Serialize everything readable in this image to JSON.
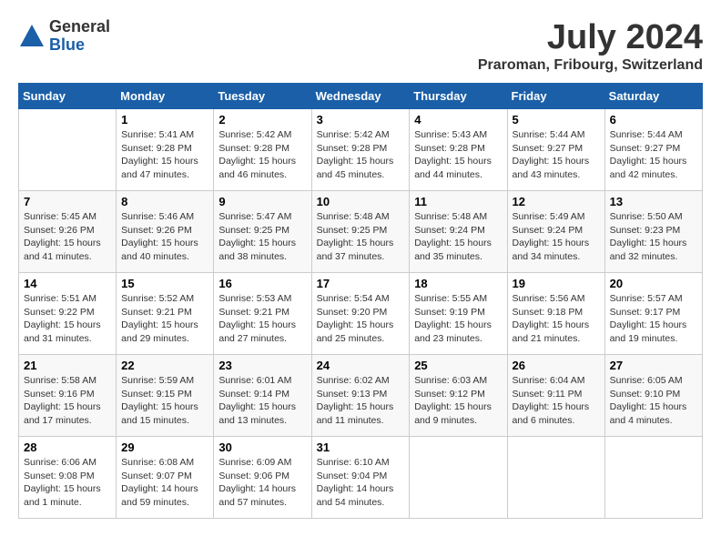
{
  "logo": {
    "general": "General",
    "blue": "Blue"
  },
  "title": "July 2024",
  "location": "Praroman, Fribourg, Switzerland",
  "days_of_week": [
    "Sunday",
    "Monday",
    "Tuesday",
    "Wednesday",
    "Thursday",
    "Friday",
    "Saturday"
  ],
  "weeks": [
    [
      {
        "num": "",
        "info": ""
      },
      {
        "num": "1",
        "info": "Sunrise: 5:41 AM\nSunset: 9:28 PM\nDaylight: 15 hours\nand 47 minutes."
      },
      {
        "num": "2",
        "info": "Sunrise: 5:42 AM\nSunset: 9:28 PM\nDaylight: 15 hours\nand 46 minutes."
      },
      {
        "num": "3",
        "info": "Sunrise: 5:42 AM\nSunset: 9:28 PM\nDaylight: 15 hours\nand 45 minutes."
      },
      {
        "num": "4",
        "info": "Sunrise: 5:43 AM\nSunset: 9:28 PM\nDaylight: 15 hours\nand 44 minutes."
      },
      {
        "num": "5",
        "info": "Sunrise: 5:44 AM\nSunset: 9:27 PM\nDaylight: 15 hours\nand 43 minutes."
      },
      {
        "num": "6",
        "info": "Sunrise: 5:44 AM\nSunset: 9:27 PM\nDaylight: 15 hours\nand 42 minutes."
      }
    ],
    [
      {
        "num": "7",
        "info": "Sunrise: 5:45 AM\nSunset: 9:26 PM\nDaylight: 15 hours\nand 41 minutes."
      },
      {
        "num": "8",
        "info": "Sunrise: 5:46 AM\nSunset: 9:26 PM\nDaylight: 15 hours\nand 40 minutes."
      },
      {
        "num": "9",
        "info": "Sunrise: 5:47 AM\nSunset: 9:25 PM\nDaylight: 15 hours\nand 38 minutes."
      },
      {
        "num": "10",
        "info": "Sunrise: 5:48 AM\nSunset: 9:25 PM\nDaylight: 15 hours\nand 37 minutes."
      },
      {
        "num": "11",
        "info": "Sunrise: 5:48 AM\nSunset: 9:24 PM\nDaylight: 15 hours\nand 35 minutes."
      },
      {
        "num": "12",
        "info": "Sunrise: 5:49 AM\nSunset: 9:24 PM\nDaylight: 15 hours\nand 34 minutes."
      },
      {
        "num": "13",
        "info": "Sunrise: 5:50 AM\nSunset: 9:23 PM\nDaylight: 15 hours\nand 32 minutes."
      }
    ],
    [
      {
        "num": "14",
        "info": "Sunrise: 5:51 AM\nSunset: 9:22 PM\nDaylight: 15 hours\nand 31 minutes."
      },
      {
        "num": "15",
        "info": "Sunrise: 5:52 AM\nSunset: 9:21 PM\nDaylight: 15 hours\nand 29 minutes."
      },
      {
        "num": "16",
        "info": "Sunrise: 5:53 AM\nSunset: 9:21 PM\nDaylight: 15 hours\nand 27 minutes."
      },
      {
        "num": "17",
        "info": "Sunrise: 5:54 AM\nSunset: 9:20 PM\nDaylight: 15 hours\nand 25 minutes."
      },
      {
        "num": "18",
        "info": "Sunrise: 5:55 AM\nSunset: 9:19 PM\nDaylight: 15 hours\nand 23 minutes."
      },
      {
        "num": "19",
        "info": "Sunrise: 5:56 AM\nSunset: 9:18 PM\nDaylight: 15 hours\nand 21 minutes."
      },
      {
        "num": "20",
        "info": "Sunrise: 5:57 AM\nSunset: 9:17 PM\nDaylight: 15 hours\nand 19 minutes."
      }
    ],
    [
      {
        "num": "21",
        "info": "Sunrise: 5:58 AM\nSunset: 9:16 PM\nDaylight: 15 hours\nand 17 minutes."
      },
      {
        "num": "22",
        "info": "Sunrise: 5:59 AM\nSunset: 9:15 PM\nDaylight: 15 hours\nand 15 minutes."
      },
      {
        "num": "23",
        "info": "Sunrise: 6:01 AM\nSunset: 9:14 PM\nDaylight: 15 hours\nand 13 minutes."
      },
      {
        "num": "24",
        "info": "Sunrise: 6:02 AM\nSunset: 9:13 PM\nDaylight: 15 hours\nand 11 minutes."
      },
      {
        "num": "25",
        "info": "Sunrise: 6:03 AM\nSunset: 9:12 PM\nDaylight: 15 hours\nand 9 minutes."
      },
      {
        "num": "26",
        "info": "Sunrise: 6:04 AM\nSunset: 9:11 PM\nDaylight: 15 hours\nand 6 minutes."
      },
      {
        "num": "27",
        "info": "Sunrise: 6:05 AM\nSunset: 9:10 PM\nDaylight: 15 hours\nand 4 minutes."
      }
    ],
    [
      {
        "num": "28",
        "info": "Sunrise: 6:06 AM\nSunset: 9:08 PM\nDaylight: 15 hours\nand 1 minute."
      },
      {
        "num": "29",
        "info": "Sunrise: 6:08 AM\nSunset: 9:07 PM\nDaylight: 14 hours\nand 59 minutes."
      },
      {
        "num": "30",
        "info": "Sunrise: 6:09 AM\nSunset: 9:06 PM\nDaylight: 14 hours\nand 57 minutes."
      },
      {
        "num": "31",
        "info": "Sunrise: 6:10 AM\nSunset: 9:04 PM\nDaylight: 14 hours\nand 54 minutes."
      },
      {
        "num": "",
        "info": ""
      },
      {
        "num": "",
        "info": ""
      },
      {
        "num": "",
        "info": ""
      }
    ]
  ]
}
